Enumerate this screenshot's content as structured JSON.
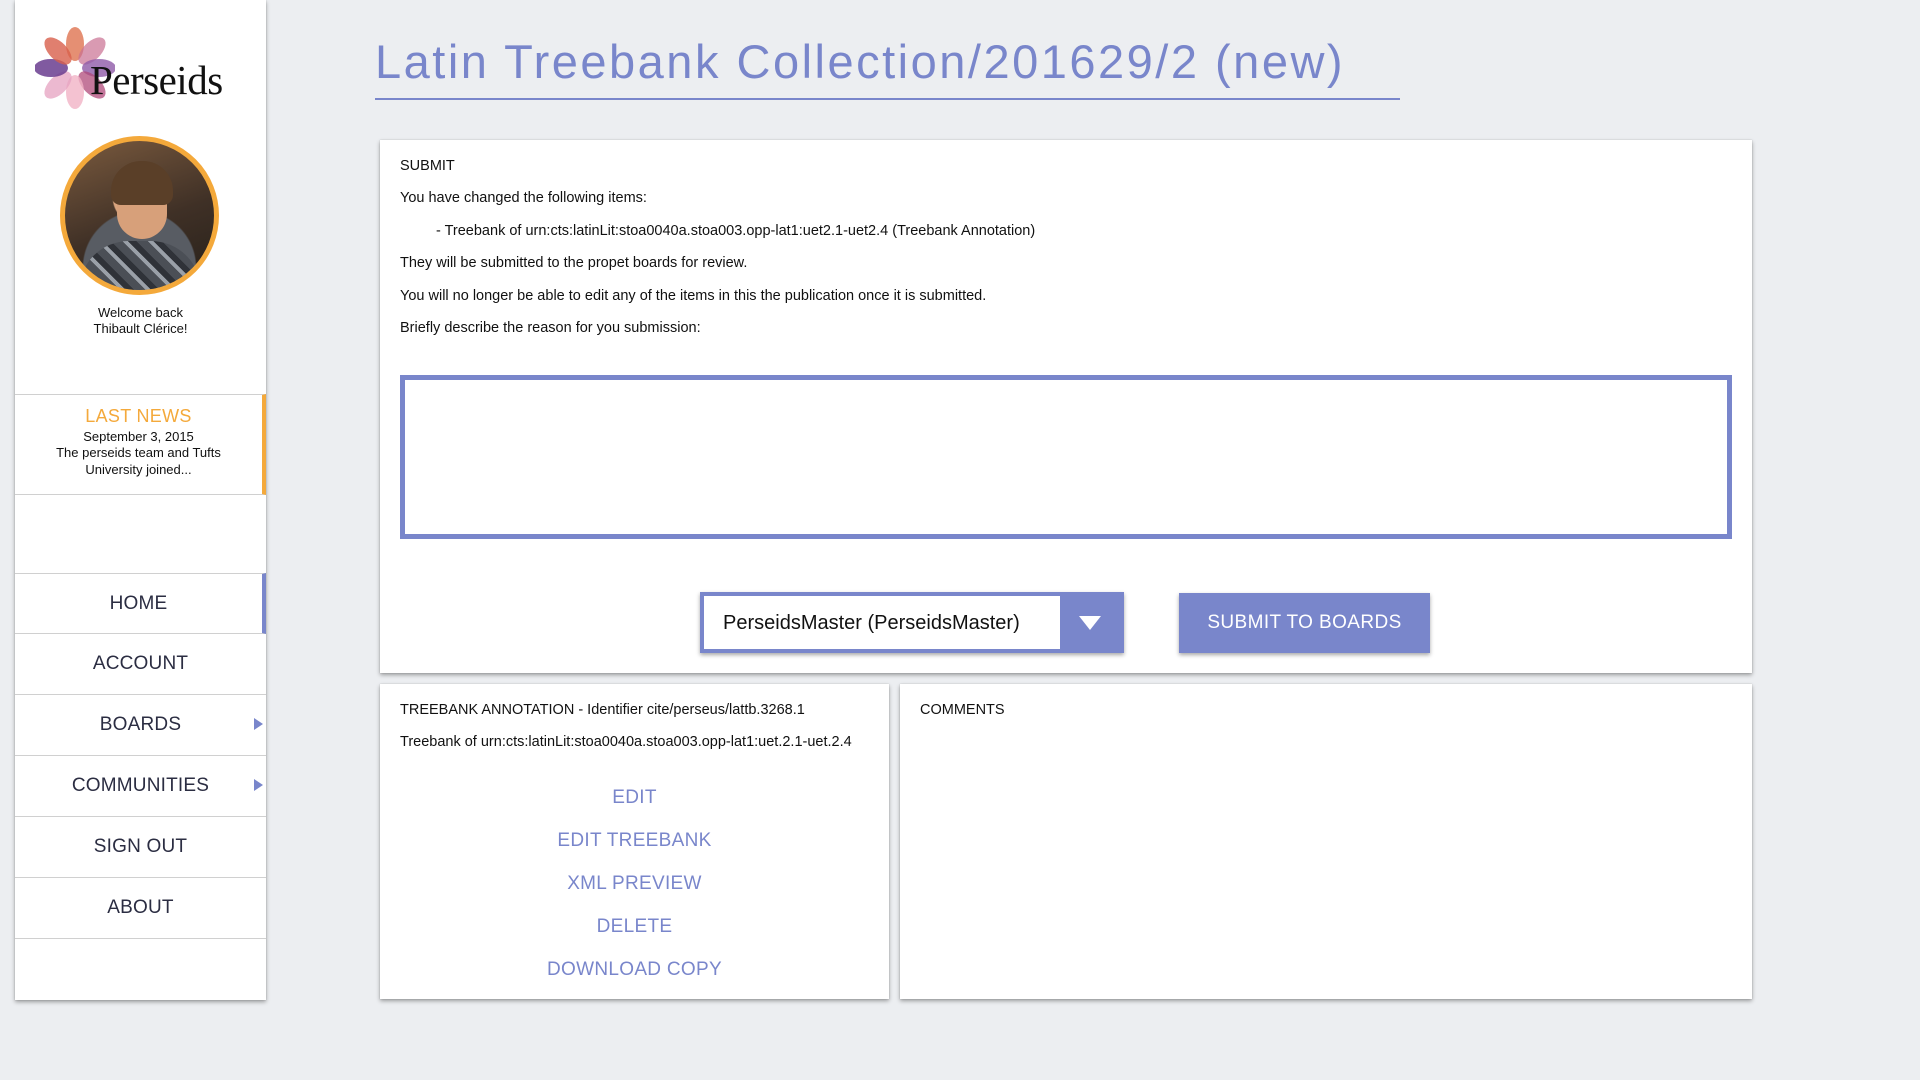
{
  "sidebar": {
    "logo_text": "Perseids",
    "welcome_line1": "Welcome back",
    "welcome_line2": "Thibault Clérice!",
    "news": {
      "title": "LAST NEWS",
      "date": "September 3, 2015",
      "body": "The perseids team and Tufts University joined..."
    },
    "nav": [
      {
        "label": "HOME",
        "active": true,
        "has_submenu": false
      },
      {
        "label": "ACCOUNT",
        "active": false,
        "has_submenu": false
      },
      {
        "label": "BOARDS",
        "active": false,
        "has_submenu": true
      },
      {
        "label": "COMMUNITIES",
        "active": false,
        "has_submenu": true
      },
      {
        "label": "SIGN OUT",
        "active": false,
        "has_submenu": false
      },
      {
        "label": "ABOUT",
        "active": false,
        "has_submenu": false
      }
    ]
  },
  "header": {
    "title": "Latin Treebank Collection/201629/2 (new)"
  },
  "submit_panel": {
    "heading": "SUBMIT",
    "changed_intro": "You have changed the following items:",
    "changed_item": "- Treebank of urn:cts:latinLit:stoa0040a.stoa003.opp-lat1:uet2.1-uet2.4 (Treebank Annotation)",
    "boards_note": "They will be submitted to the propet boards for review.",
    "lock_note": "You will no longer be able to edit any of the items in this the publication once it is submitted.",
    "reason_prompt": "Briefly describe the reason for you submission:",
    "reason_value": "",
    "board_selected": "PerseidsMaster (PerseidsMaster)",
    "submit_label": "SUBMIT TO BOARDS"
  },
  "treebank_panel": {
    "heading": "TREEBANK ANNOTATION - Identifier cite/perseus/lattb.3268.1",
    "description": "Treebank of urn:cts:latinLit:stoa0040a.stoa003.opp-lat1:uet.2.1-uet.2.4",
    "actions": [
      "EDIT",
      "EDIT TREEBANK",
      "XML PREVIEW",
      "DELETE",
      "DOWNLOAD COPY"
    ]
  },
  "comments_panel": {
    "heading": "COMMENTS"
  },
  "colors": {
    "accent": "#7986cb",
    "news_accent": "#f4a93b",
    "background": "#eceef1"
  }
}
